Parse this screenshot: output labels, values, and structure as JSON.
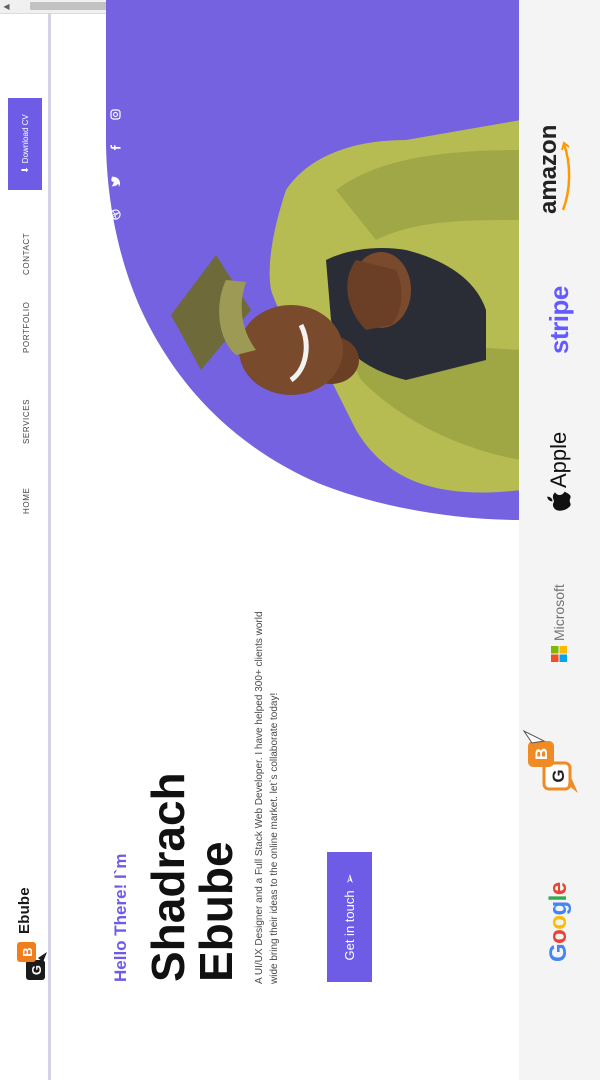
{
  "brand": {
    "letter_g": "G",
    "letter_b": "B",
    "name": "Ebube"
  },
  "nav": {
    "items": [
      {
        "label": "HOME"
      },
      {
        "label": "SERVICES"
      },
      {
        "label": "PORTFOLIO"
      },
      {
        "label": "CONTACT"
      }
    ],
    "download_label": "Download CV"
  },
  "hero": {
    "greeting": "Hello There! I`m",
    "first_name": "Shadrach",
    "last_name": "Ebube",
    "description": "A UI/UX Designer and a Full Stack Web Developer. I have helped 300+ clients world wide bring their ideas to the online market. let`s collaborate today!",
    "cta_label": "Get in touch"
  },
  "social_icons": [
    "instagram-icon",
    "facebook-icon",
    "twitter-icon",
    "dribbble-icon"
  ],
  "brands": {
    "google": "Google",
    "gb_g": "G",
    "gb_b": "B",
    "microsoft": "Microsoft",
    "apple": "Apple",
    "stripe": "stripe",
    "amazon": "amazon"
  },
  "colors": {
    "accent": "#6e5ce6",
    "text": "#111111",
    "strip_bg": "#f4f4f4"
  }
}
